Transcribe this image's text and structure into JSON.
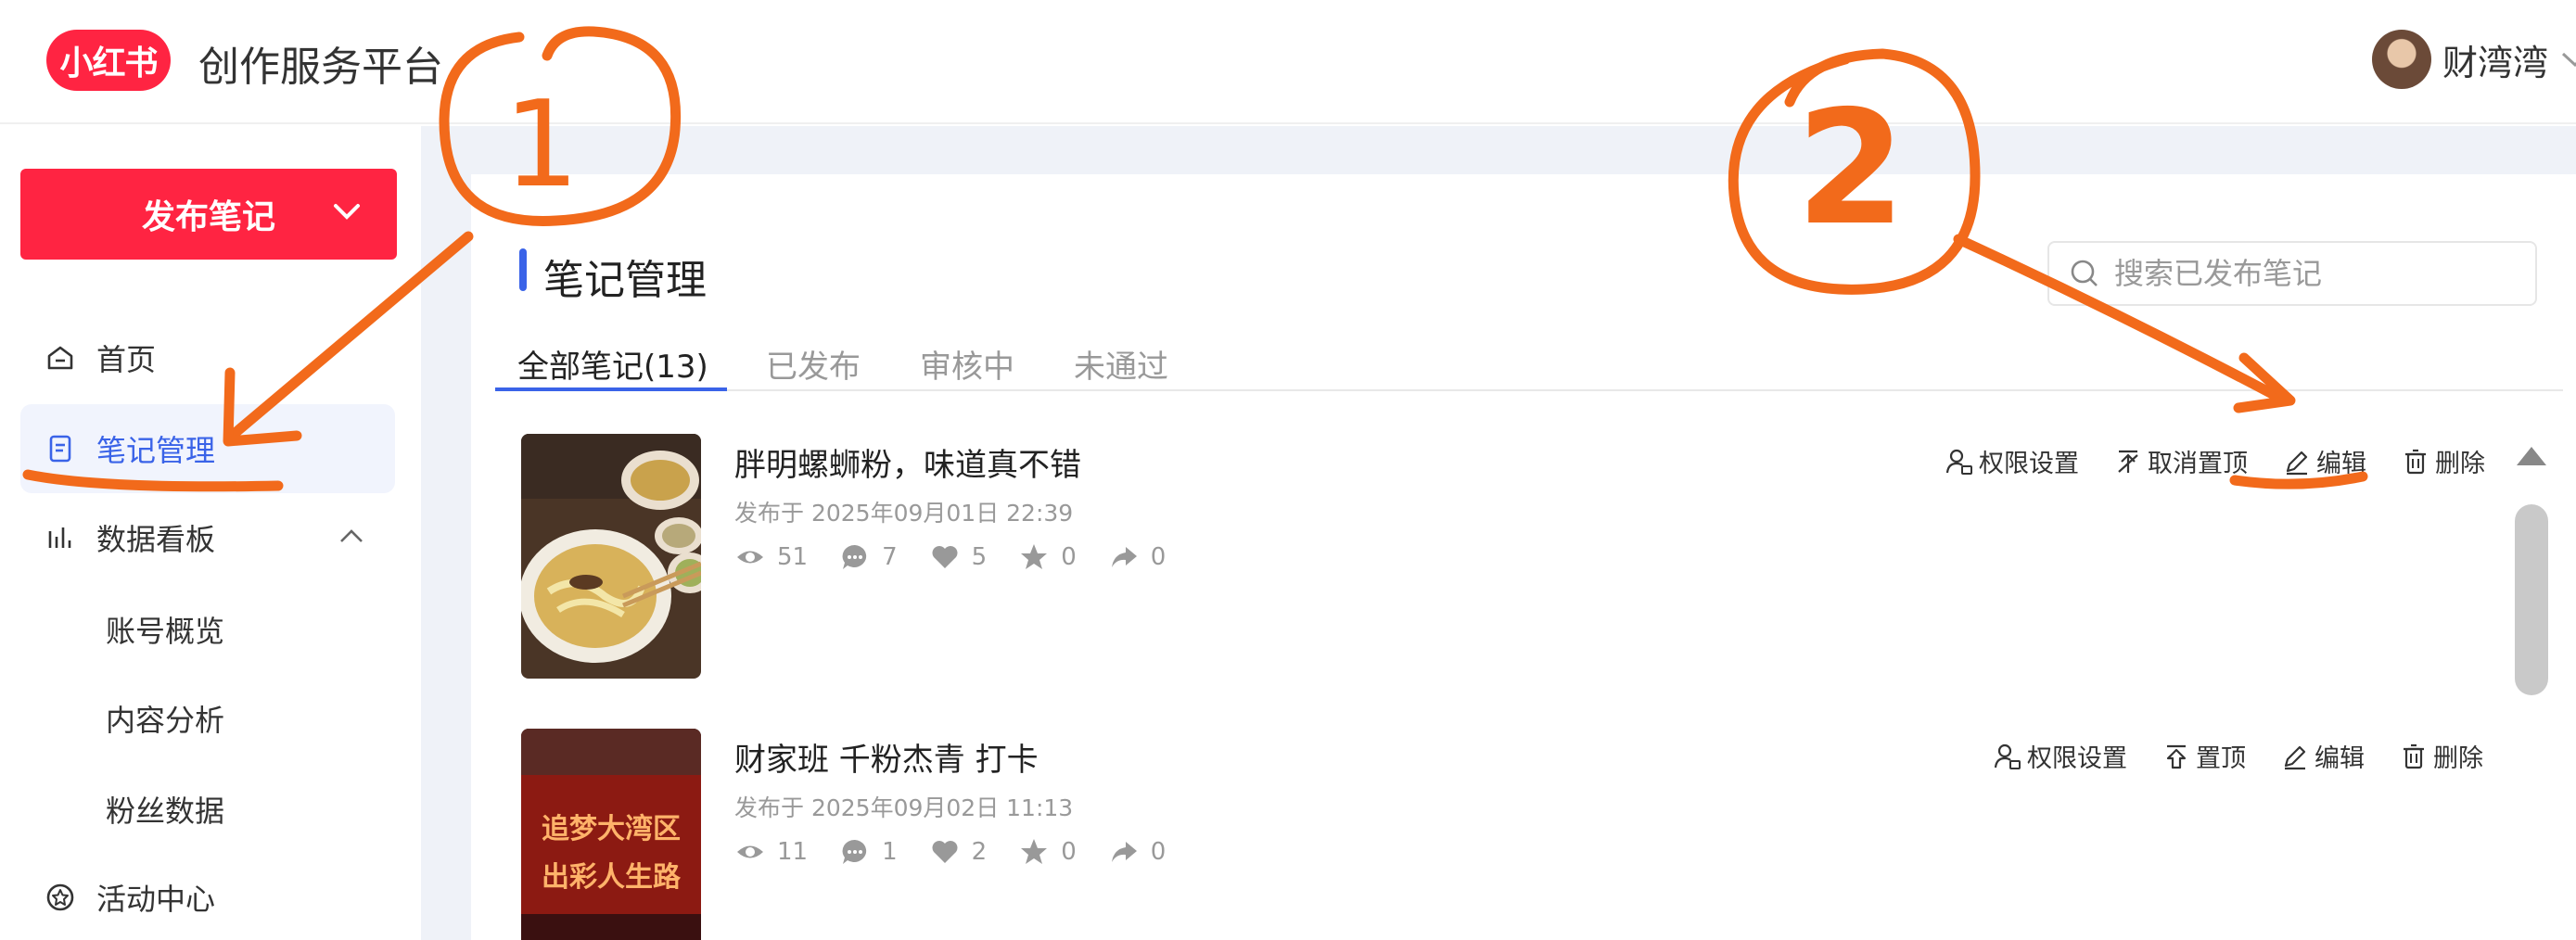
{
  "header": {
    "logo_text": "小红书",
    "platform_title": "创作服务平台",
    "user_name": "财湾湾"
  },
  "sidebar": {
    "publish_label": "发布笔记",
    "items": [
      {
        "label": "首页",
        "icon": "home-icon"
      },
      {
        "label": "笔记管理",
        "icon": "note-icon",
        "active": true
      },
      {
        "label": "数据看板",
        "icon": "chart-icon",
        "expanded": true
      },
      {
        "label": "账号概览",
        "sub": true
      },
      {
        "label": "内容分析",
        "sub": true
      },
      {
        "label": "粉丝数据",
        "sub": true
      },
      {
        "label": "活动中心",
        "icon": "star-badge-icon"
      }
    ]
  },
  "main": {
    "page_title": "笔记管理",
    "search_placeholder": "搜索已发布笔记",
    "tabs": [
      {
        "label": "全部笔记(13)",
        "active": true
      },
      {
        "label": "已发布"
      },
      {
        "label": "审核中"
      },
      {
        "label": "未通过"
      }
    ],
    "notes": [
      {
        "title": "胖明螺蛳粉，味道真不错",
        "date": "发布于 2025年09月01日 22:39",
        "views": "51",
        "comments": "7",
        "likes": "5",
        "collects": "0",
        "shares": "0",
        "actions": [
          "权限设置",
          "取消置顶",
          "编辑",
          "删除"
        ]
      },
      {
        "title": "财家班 千粉杰青 打卡",
        "date": "发布于 2025年09月02日 11:13",
        "views": "11",
        "comments": "1",
        "likes": "2",
        "collects": "0",
        "shares": "0",
        "actions": [
          "权限设置",
          "置顶",
          "编辑",
          "删除"
        ],
        "thumb_text": [
          "追梦大湾区",
          "出彩人生路"
        ]
      }
    ]
  },
  "annotations": {
    "mark_1": "1",
    "mark_2": "2",
    "color": "#f26a1b"
  },
  "colors": {
    "brand_red": "#ff2442",
    "accent_blue": "#3a63e8"
  }
}
